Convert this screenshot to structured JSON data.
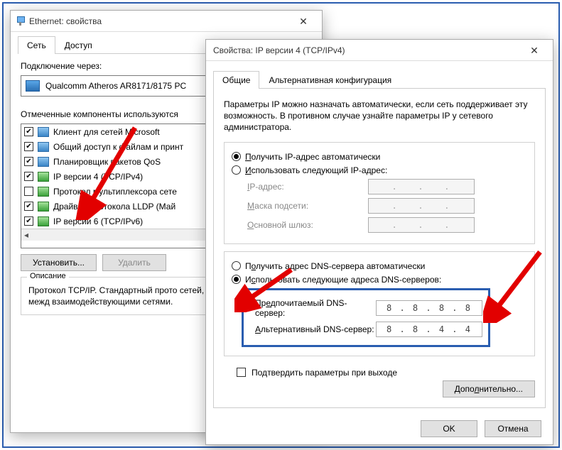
{
  "ethernet_window": {
    "title": "Ethernet: свойства",
    "tabs": [
      "Сеть",
      "Доступ"
    ],
    "active_tab": 0,
    "connect_label": "Подключение через:",
    "adapter": "Qualcomm Atheros AR8171/8175 PC",
    "components_label": "Отмеченные компоненты используются",
    "components": [
      {
        "checked": true,
        "type": "svc",
        "label": "Клиент для сетей Microsoft"
      },
      {
        "checked": true,
        "type": "svc",
        "label": "Общий доступ к файлам и принт"
      },
      {
        "checked": true,
        "type": "svc",
        "label": "Планировщик пакетов QoS"
      },
      {
        "checked": true,
        "type": "proto",
        "label": "IP версии 4 (TCP/IPv4)"
      },
      {
        "checked": false,
        "type": "proto",
        "label": "Протокол мультиплексора сете"
      },
      {
        "checked": true,
        "type": "proto",
        "label": "Драйвер протокола LLDP (Май"
      },
      {
        "checked": true,
        "type": "proto",
        "label": "IP версии 6 (TCP/IPv6)"
      }
    ],
    "install_btn": "Установить...",
    "uninstall_btn": "Удалить",
    "desc_title": "Описание",
    "desc_text": "Протокол TCP/IP. Стандартный прото сетей, обеспечивающий связь межд взаимодействующими сетями."
  },
  "ipv4_window": {
    "title": "Свойства: IP версии 4 (TCP/IPv4)",
    "tabs": [
      "Общие",
      "Альтернативная конфигурация"
    ],
    "active_tab": 0,
    "intro": "Параметры IP можно назначать автоматически, если сеть поддерживает эту возможность. В противном случае узнайте параметры IP у сетевого администратора.",
    "ip_auto": "Получить IP-адрес автоматически",
    "ip_manual": "Использовать следующий IP-адрес:",
    "ip_fields": {
      "address": "IP-адрес:",
      "mask": "Маска подсети:",
      "gateway": "Основной шлюз:"
    },
    "dns_auto": "Получить адрес DNS-сервера автоматически",
    "dns_manual": "Использовать следующие адреса DNS-серверов:",
    "dns_fields": {
      "preferred_label": "Предпочитаемый DNS-сервер:",
      "preferred_value": "8 . 8 . 8 . 8",
      "alternate_label": "Альтернативный DNS-сервер:",
      "alternate_value": "8 . 8 . 4 . 4"
    },
    "validate_label": "Подтвердить параметры при выходе",
    "advanced_btn": "Дополнительно...",
    "ok_btn": "OK",
    "cancel_btn": "Отмена"
  }
}
